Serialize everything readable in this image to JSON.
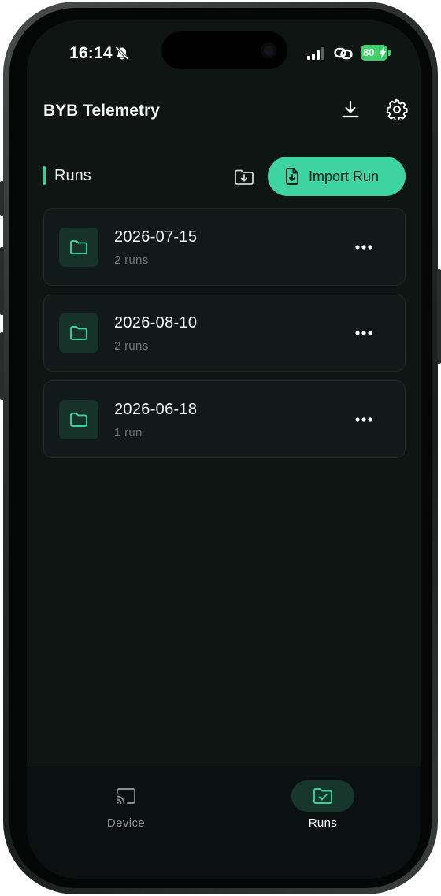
{
  "status_bar": {
    "time": "16:14",
    "battery": "80",
    "icons": [
      "bell-slash-icon",
      "signal-icon",
      "link-icon",
      "battery-icon"
    ]
  },
  "header": {
    "title": "BYB Telemetry",
    "icons": [
      "download-icon",
      "gear-icon"
    ]
  },
  "section": {
    "title": "Runs",
    "import_label": "Import Run",
    "icons": [
      "folder-download-icon",
      "file-import-icon"
    ]
  },
  "runs": [
    {
      "name": "2026-07-15",
      "count": "2 runs"
    },
    {
      "name": "2026-08-10",
      "count": "2 runs"
    },
    {
      "name": "2026-06-18",
      "count": "1 run"
    }
  ],
  "bottom_nav": {
    "items": [
      {
        "label": "Device",
        "icon": "cast-icon",
        "active": false
      },
      {
        "label": "Runs",
        "icon": "folder-check-icon",
        "active": true
      }
    ]
  },
  "colors": {
    "accent": "#3dd4a1",
    "background": "#0e1513",
    "card": "#111a18",
    "battery": "#3ecf6a"
  }
}
